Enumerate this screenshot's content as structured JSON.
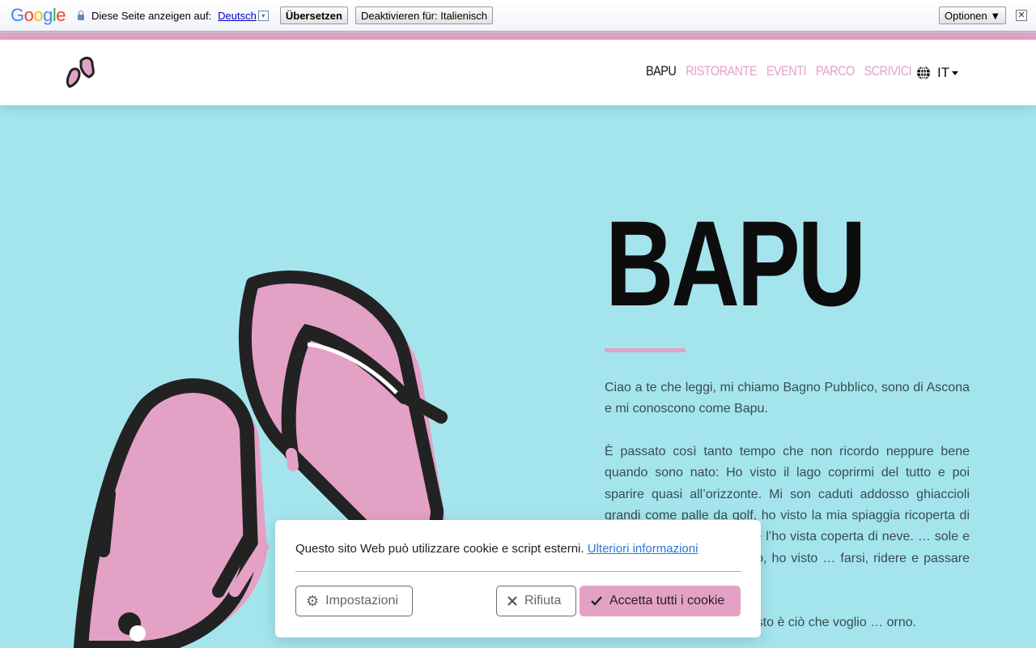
{
  "translate_bar": {
    "logo_letters": [
      "G",
      "o",
      "o",
      "g",
      "l",
      "e"
    ],
    "prompt": "Diese Seite anzeigen auf:",
    "language": "Deutsch",
    "dropdown_glyph": "▾",
    "translate_button": "Übersetzen",
    "disable_button": "Deaktivieren für: Italienisch",
    "options_button": "Optionen ▼",
    "close_glyph": "✕"
  },
  "nav": {
    "items": [
      "BAPU",
      "RISTORANTE",
      "EVENTI",
      "PARCO",
      "SCRIVICI"
    ],
    "active_index": 0,
    "language": "IT"
  },
  "hero": {
    "title": "BAPU",
    "paragraphs": [
      "Ciao a te che leggi, mi chiamo Bagno Pubblico, sono di Ascona e mi conoscono come Bapu.",
      "È passato così tanto tempo che non ricordo neppure bene quando sono nato: Ho visto il lago coprirmi del tutto e poi sparire quasi all’orizzonte. Mi son caduti addosso ghiaccioli grandi come palle da golf,  ho visto la mia spiaggia ricoperta di legna portata dalla buzza e l’ho vista coperta di neve. … sole e la pioggia… ma soprattutto, ho visto … farsi, ridere e passare qui con me, giornate",
      "… te della mia natura, questo è ciò che voglio … orno."
    ]
  },
  "cookie": {
    "message": "Questo sito Web può utilizzare cookie e script esterni.",
    "link": "Ulteriori informazioni",
    "settings_label": "Impostazioni",
    "refuse_label": "Rifiuta",
    "accept_label": "Accetta tutti i cookie"
  },
  "colors": {
    "pink": "#e4a1c6",
    "background": "#a4e5ed",
    "text_dark": "#0d0d0d"
  }
}
